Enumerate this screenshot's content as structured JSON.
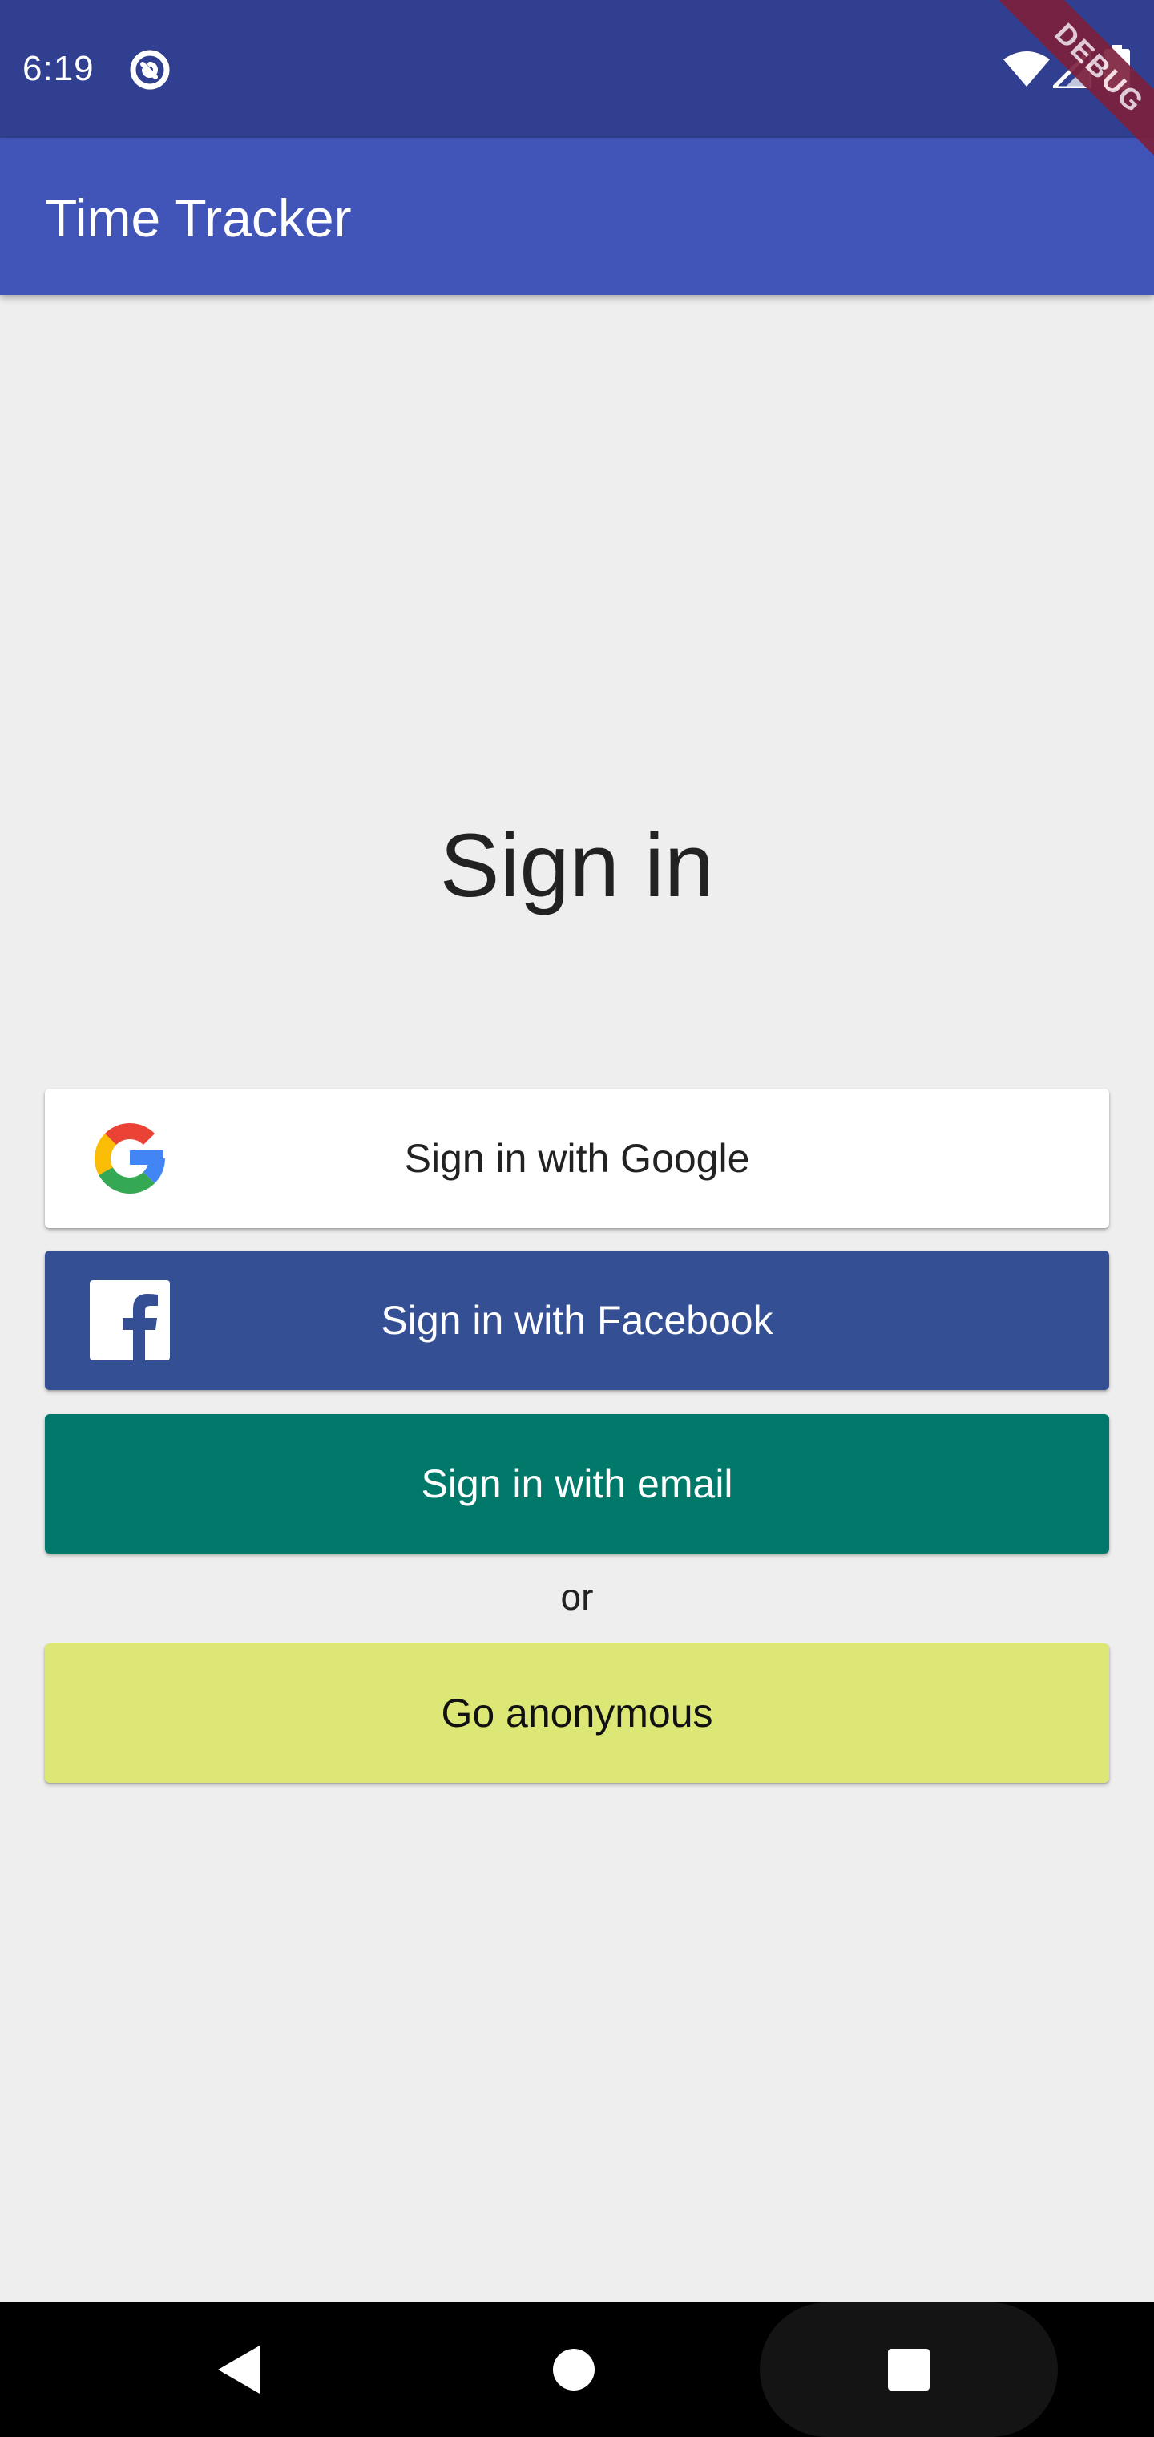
{
  "status_bar": {
    "time": "6:19",
    "icons": [
      "app-notification-icon",
      "wifi-icon",
      "signal-icon",
      "battery-icon"
    ]
  },
  "debug_banner": "DEBUG",
  "app_bar": {
    "title": "Time Tracker"
  },
  "main": {
    "heading": "Sign in",
    "google_button": {
      "label": "Sign in with Google",
      "icon": "google-logo-icon"
    },
    "facebook_button": {
      "label": "Sign in with Facebook",
      "icon": "facebook-logo-icon"
    },
    "email_button": {
      "label": "Sign in with email"
    },
    "separator": "or",
    "anonymous_button": {
      "label": "Go anonymous"
    }
  },
  "colors": {
    "status_bar": "#303f8f",
    "app_bar": "#4154b8",
    "background": "#eeeeee",
    "facebook": "#344f94",
    "email": "#00796b",
    "anonymous": "#dce775",
    "debug_ribbon": "#7d1f3b"
  },
  "nav_bar": {
    "icons": [
      "back-icon",
      "home-icon",
      "recents-icon"
    ]
  }
}
